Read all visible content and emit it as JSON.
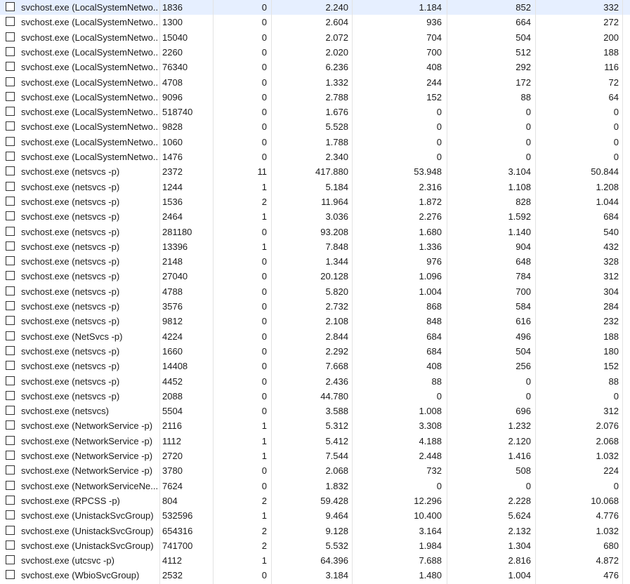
{
  "rows": [
    {
      "name": "svchost.exe (LocalSystemNetwo...",
      "pid": "1836",
      "threads": "0",
      "c3": "2.240",
      "c4": "1.184",
      "c5": "852",
      "c6": "332",
      "selected": true
    },
    {
      "name": "svchost.exe (LocalSystemNetwo...",
      "pid": "1300",
      "threads": "0",
      "c3": "2.604",
      "c4": "936",
      "c5": "664",
      "c6": "272"
    },
    {
      "name": "svchost.exe (LocalSystemNetwo...",
      "pid": "15040",
      "threads": "0",
      "c3": "2.072",
      "c4": "704",
      "c5": "504",
      "c6": "200"
    },
    {
      "name": "svchost.exe (LocalSystemNetwo...",
      "pid": "2260",
      "threads": "0",
      "c3": "2.020",
      "c4": "700",
      "c5": "512",
      "c6": "188"
    },
    {
      "name": "svchost.exe (LocalSystemNetwo...",
      "pid": "76340",
      "threads": "0",
      "c3": "6.236",
      "c4": "408",
      "c5": "292",
      "c6": "116"
    },
    {
      "name": "svchost.exe (LocalSystemNetwo...",
      "pid": "4708",
      "threads": "0",
      "c3": "1.332",
      "c4": "244",
      "c5": "172",
      "c6": "72"
    },
    {
      "name": "svchost.exe (LocalSystemNetwo...",
      "pid": "9096",
      "threads": "0",
      "c3": "2.788",
      "c4": "152",
      "c5": "88",
      "c6": "64"
    },
    {
      "name": "svchost.exe (LocalSystemNetwo...",
      "pid": "518740",
      "threads": "0",
      "c3": "1.676",
      "c4": "0",
      "c5": "0",
      "c6": "0"
    },
    {
      "name": "svchost.exe (LocalSystemNetwo...",
      "pid": "9828",
      "threads": "0",
      "c3": "5.528",
      "c4": "0",
      "c5": "0",
      "c6": "0"
    },
    {
      "name": "svchost.exe (LocalSystemNetwo...",
      "pid": "1060",
      "threads": "0",
      "c3": "1.788",
      "c4": "0",
      "c5": "0",
      "c6": "0"
    },
    {
      "name": "svchost.exe (LocalSystemNetwo...",
      "pid": "1476",
      "threads": "0",
      "c3": "2.340",
      "c4": "0",
      "c5": "0",
      "c6": "0"
    },
    {
      "name": "svchost.exe (netsvcs -p)",
      "pid": "2372",
      "threads": "11",
      "c3": "417.880",
      "c4": "53.948",
      "c5": "3.104",
      "c6": "50.844"
    },
    {
      "name": "svchost.exe (netsvcs -p)",
      "pid": "1244",
      "threads": "1",
      "c3": "5.184",
      "c4": "2.316",
      "c5": "1.108",
      "c6": "1.208"
    },
    {
      "name": "svchost.exe (netsvcs -p)",
      "pid": "1536",
      "threads": "2",
      "c3": "11.964",
      "c4": "1.872",
      "c5": "828",
      "c6": "1.044"
    },
    {
      "name": "svchost.exe (netsvcs -p)",
      "pid": "2464",
      "threads": "1",
      "c3": "3.036",
      "c4": "2.276",
      "c5": "1.592",
      "c6": "684"
    },
    {
      "name": "svchost.exe (netsvcs -p)",
      "pid": "281180",
      "threads": "0",
      "c3": "93.208",
      "c4": "1.680",
      "c5": "1.140",
      "c6": "540"
    },
    {
      "name": "svchost.exe (netsvcs -p)",
      "pid": "13396",
      "threads": "1",
      "c3": "7.848",
      "c4": "1.336",
      "c5": "904",
      "c6": "432"
    },
    {
      "name": "svchost.exe (netsvcs -p)",
      "pid": "2148",
      "threads": "0",
      "c3": "1.344",
      "c4": "976",
      "c5": "648",
      "c6": "328"
    },
    {
      "name": "svchost.exe (netsvcs -p)",
      "pid": "27040",
      "threads": "0",
      "c3": "20.128",
      "c4": "1.096",
      "c5": "784",
      "c6": "312"
    },
    {
      "name": "svchost.exe (netsvcs -p)",
      "pid": "4788",
      "threads": "0",
      "c3": "5.820",
      "c4": "1.004",
      "c5": "700",
      "c6": "304"
    },
    {
      "name": "svchost.exe (netsvcs -p)",
      "pid": "3576",
      "threads": "0",
      "c3": "2.732",
      "c4": "868",
      "c5": "584",
      "c6": "284"
    },
    {
      "name": "svchost.exe (netsvcs -p)",
      "pid": "9812",
      "threads": "0",
      "c3": "2.108",
      "c4": "848",
      "c5": "616",
      "c6": "232"
    },
    {
      "name": "svchost.exe (NetSvcs -p)",
      "pid": "4224",
      "threads": "0",
      "c3": "2.844",
      "c4": "684",
      "c5": "496",
      "c6": "188"
    },
    {
      "name": "svchost.exe (netsvcs -p)",
      "pid": "1660",
      "threads": "0",
      "c3": "2.292",
      "c4": "684",
      "c5": "504",
      "c6": "180"
    },
    {
      "name": "svchost.exe (netsvcs -p)",
      "pid": "14408",
      "threads": "0",
      "c3": "7.668",
      "c4": "408",
      "c5": "256",
      "c6": "152"
    },
    {
      "name": "svchost.exe (netsvcs -p)",
      "pid": "4452",
      "threads": "0",
      "c3": "2.436",
      "c4": "88",
      "c5": "0",
      "c6": "88"
    },
    {
      "name": "svchost.exe (netsvcs -p)",
      "pid": "2088",
      "threads": "0",
      "c3": "44.780",
      "c4": "0",
      "c5": "0",
      "c6": "0"
    },
    {
      "name": "svchost.exe (netsvcs)",
      "pid": "5504",
      "threads": "0",
      "c3": "3.588",
      "c4": "1.008",
      "c5": "696",
      "c6": "312"
    },
    {
      "name": "svchost.exe (NetworkService -p)",
      "pid": "2116",
      "threads": "1",
      "c3": "5.312",
      "c4": "3.308",
      "c5": "1.232",
      "c6": "2.076"
    },
    {
      "name": "svchost.exe (NetworkService -p)",
      "pid": "1112",
      "threads": "1",
      "c3": "5.412",
      "c4": "4.188",
      "c5": "2.120",
      "c6": "2.068"
    },
    {
      "name": "svchost.exe (NetworkService -p)",
      "pid": "2720",
      "threads": "1",
      "c3": "7.544",
      "c4": "2.448",
      "c5": "1.416",
      "c6": "1.032"
    },
    {
      "name": "svchost.exe (NetworkService -p)",
      "pid": "3780",
      "threads": "0",
      "c3": "2.068",
      "c4": "732",
      "c5": "508",
      "c6": "224"
    },
    {
      "name": "svchost.exe (NetworkServiceNe...",
      "pid": "7624",
      "threads": "0",
      "c3": "1.832",
      "c4": "0",
      "c5": "0",
      "c6": "0"
    },
    {
      "name": "svchost.exe (RPCSS -p)",
      "pid": "804",
      "threads": "2",
      "c3": "59.428",
      "c4": "12.296",
      "c5": "2.228",
      "c6": "10.068"
    },
    {
      "name": "svchost.exe (UnistackSvcGroup)",
      "pid": "532596",
      "threads": "1",
      "c3": "9.464",
      "c4": "10.400",
      "c5": "5.624",
      "c6": "4.776"
    },
    {
      "name": "svchost.exe (UnistackSvcGroup)",
      "pid": "654316",
      "threads": "2",
      "c3": "9.128",
      "c4": "3.164",
      "c5": "2.132",
      "c6": "1.032"
    },
    {
      "name": "svchost.exe (UnistackSvcGroup)",
      "pid": "741700",
      "threads": "2",
      "c3": "5.532",
      "c4": "1.984",
      "c5": "1.304",
      "c6": "680"
    },
    {
      "name": "svchost.exe (utcsvc -p)",
      "pid": "4112",
      "threads": "1",
      "c3": "64.396",
      "c4": "7.688",
      "c5": "2.816",
      "c6": "4.872"
    },
    {
      "name": "svchost.exe (WbioSvcGroup)",
      "pid": "2532",
      "threads": "0",
      "c3": "3.184",
      "c4": "1.480",
      "c5": "1.004",
      "c6": "476"
    }
  ]
}
